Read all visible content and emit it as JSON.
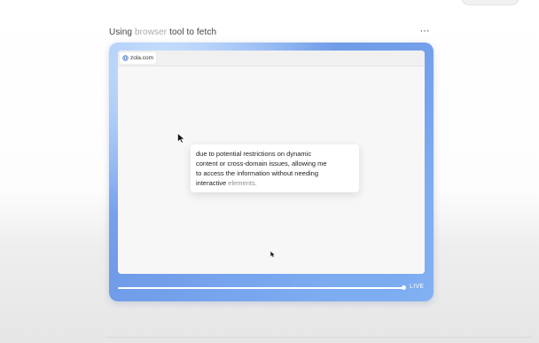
{
  "header": {
    "title_prefix": "Using ",
    "title_faded": "browser",
    "title_suffix": " tool to fetch",
    "more_label": "···"
  },
  "browser": {
    "site": "zola.com"
  },
  "thought": {
    "line1": "due to potential restrictions on dynamic",
    "line2": "content or cross-domain issues, allowing me",
    "line3": "to access the information without needing",
    "line4_main": "interactive ",
    "line4_fade": "elements."
  },
  "playback": {
    "status": "LIVE",
    "progress": 1.0
  },
  "colors": {
    "frame_accent": "#6f9be8",
    "text_primary": "#222222",
    "text_faded": "#a9a9a9"
  },
  "icons": {
    "site": "globe-icon",
    "menu": "more-dots-icon",
    "pointer": "cursor-arrow-icon"
  }
}
